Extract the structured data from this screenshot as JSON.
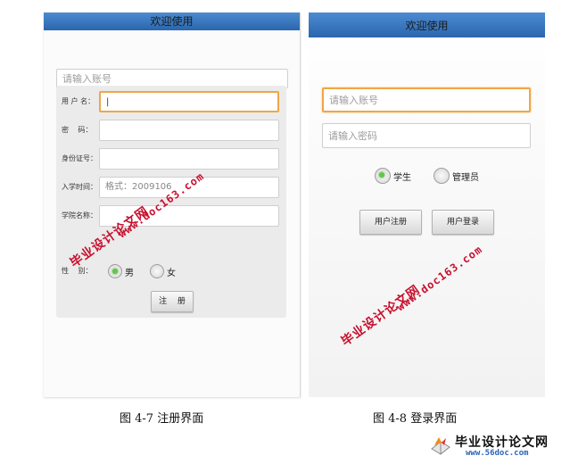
{
  "colors": {
    "titlebar": "#2a66ad",
    "focus_border": "#f0a646",
    "radio_on": "#5ec944",
    "watermark": "#c8102e"
  },
  "register": {
    "title": "欢迎使用",
    "account_placeholder": "请输入账号",
    "fields": {
      "username_label": "用 户 名：",
      "password_label": "密　 码：",
      "idcard_label": "身份证号：",
      "enroll_label": "入学时间：",
      "enroll_placeholder": "格式：2009106",
      "college_label": "学院名称："
    },
    "gender_label": "性　 别：",
    "gender_options": {
      "male": "男",
      "female": "女"
    },
    "gender_selected": "男",
    "submit_label": "注　 册"
  },
  "login": {
    "title": "欢迎使用",
    "account_placeholder": "请输入账号",
    "password_placeholder": "请输入密码",
    "role_options": {
      "student": "学生",
      "admin": "管理员"
    },
    "role_selected": "学生",
    "register_button": "用户注册",
    "login_button": "用户登录"
  },
  "captions": {
    "left": "图 4-7 注册界面",
    "right": "图 4-8 登录界面"
  },
  "watermarks": {
    "title": "毕业设计论文网",
    "url": "www.doc163.com"
  },
  "logo": {
    "name": "毕业设计论文网",
    "url": "www.56doc.com",
    "icon": "book-logo-icon"
  }
}
